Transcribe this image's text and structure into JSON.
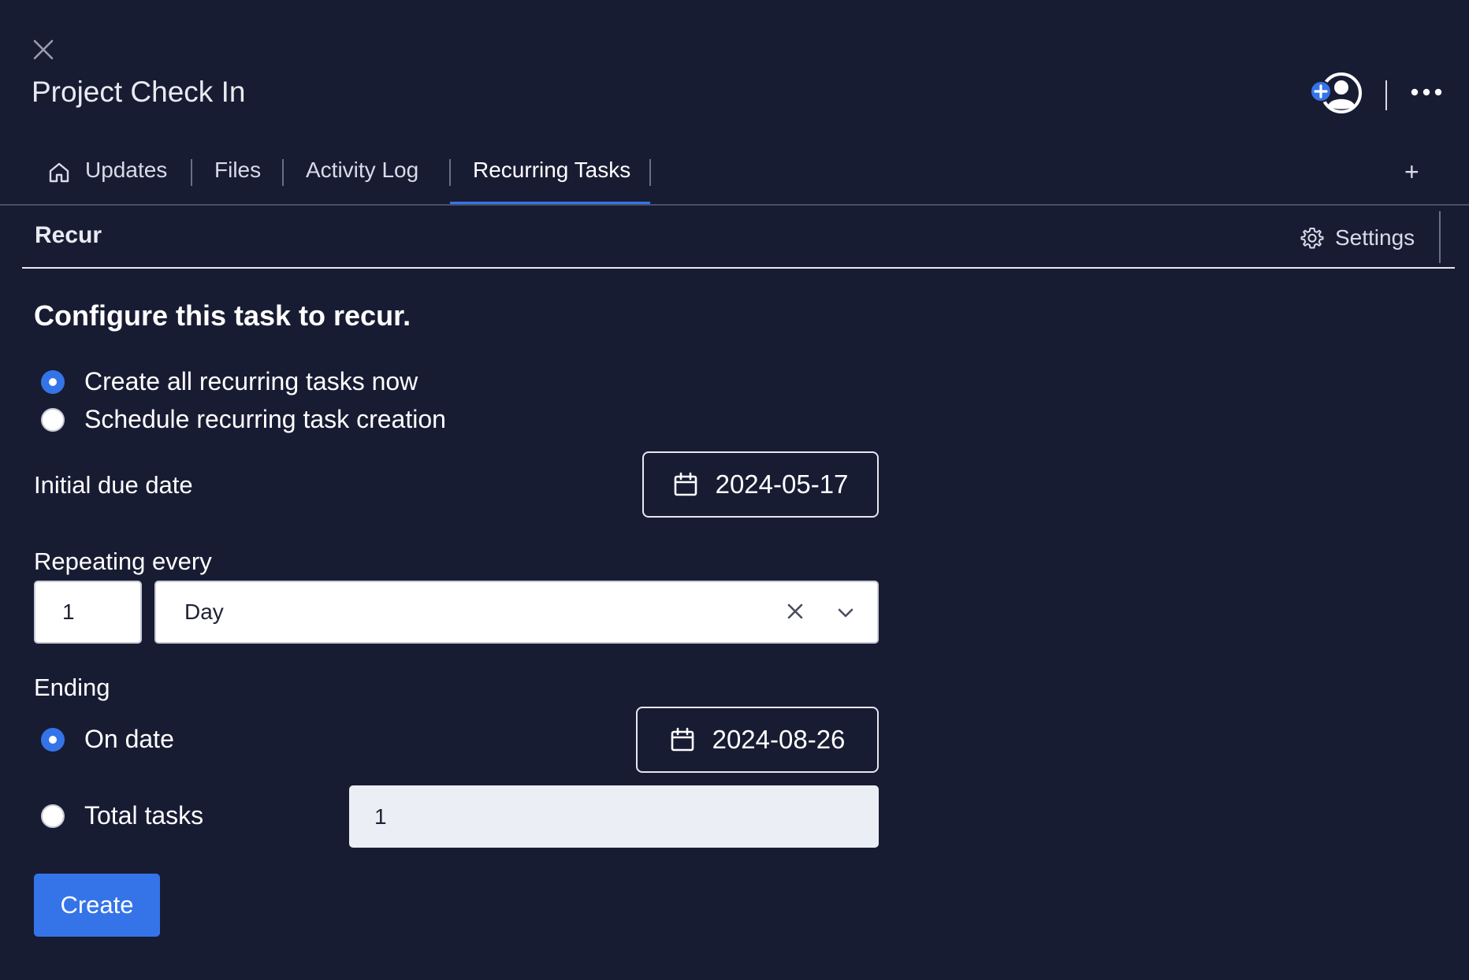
{
  "header": {
    "title": "Project Check In",
    "close_icon": "close-icon",
    "avatar_icon": "add-person-icon",
    "more_icon": "more-horizontal-icon"
  },
  "tabs": [
    {
      "label": "Updates",
      "icon": "home-icon",
      "active": false
    },
    {
      "label": "Files",
      "active": false
    },
    {
      "label": "Activity Log",
      "active": false
    },
    {
      "label": "Recurring Tasks",
      "active": true
    }
  ],
  "add_tab_label": "+",
  "recur_bar": {
    "title": "Recur",
    "settings_label": "Settings",
    "settings_icon": "gear-icon"
  },
  "form": {
    "heading": "Configure this task to recur.",
    "creation_mode": {
      "options": [
        {
          "label": "Create all recurring tasks now",
          "selected": true
        },
        {
          "label": "Schedule recurring task creation",
          "selected": false
        }
      ]
    },
    "initial_due_date": {
      "label": "Initial due date",
      "value": "2024-05-17",
      "icon": "calendar-icon"
    },
    "repeating": {
      "label": "Repeating every",
      "interval_value": "1",
      "unit_value": "Day",
      "clear_icon": "close-icon",
      "dropdown_icon": "chevron-down-icon"
    },
    "ending": {
      "label": "Ending",
      "on_date": {
        "label": "On date",
        "selected": true,
        "value": "2024-08-26"
      },
      "total_tasks": {
        "label": "Total tasks",
        "selected": false,
        "value": "1"
      }
    },
    "submit_label": "Create"
  },
  "colors": {
    "background": "#181c33",
    "accent": "#3574e8",
    "text": "#ffffff"
  }
}
